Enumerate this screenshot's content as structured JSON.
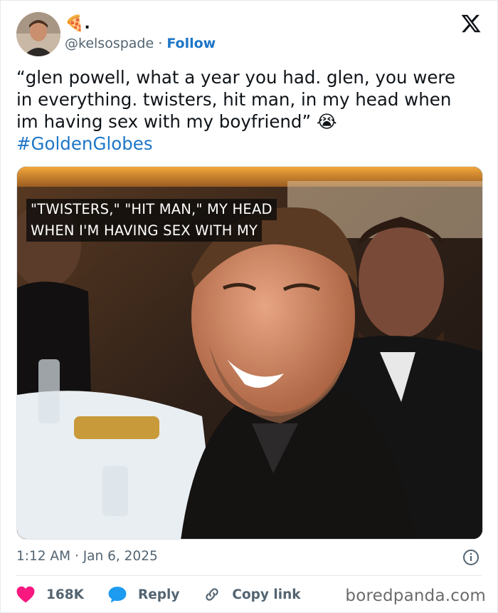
{
  "author": {
    "display_name": "🍕.",
    "handle": "@kelsospade",
    "separator": "·",
    "follow_label": "Follow"
  },
  "tweet": {
    "text_line1": "“glen powell, what a year you had. glen, you were",
    "text_line2": "in everything. twisters, hit man, in my head when",
    "text_line3": "im having sex with my boyfriend” 😭",
    "hashtag": "#GoldenGlobes"
  },
  "media": {
    "caption_line1": "\"TWISTERS,\" \"HIT MAN,\" MY HEAD",
    "caption_line2": "WHEN I'M HAVING SEX WITH MY"
  },
  "meta": {
    "time": "1:12 AM",
    "separator": "·",
    "date": "Jan 6, 2025"
  },
  "actions": {
    "likes": "168K",
    "reply_label": "Reply",
    "copy_link_label": "Copy link"
  },
  "watermark": "boredpanda.com",
  "colors": {
    "link_blue": "#1d76c7",
    "like_red": "#f91880",
    "reply_blue": "#1d9bf0",
    "muted_text": "#536471"
  }
}
